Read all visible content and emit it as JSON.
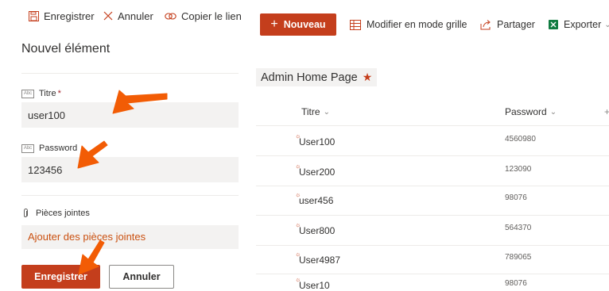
{
  "panel": {
    "commands": {
      "save": "Enregistrer",
      "cancel": "Annuler",
      "copy_link": "Copier le lien"
    },
    "title": "Nouvel élément",
    "fields": [
      {
        "label": "Titre",
        "required_mark": "*",
        "value": "user100"
      },
      {
        "label": "Password",
        "value": "123456"
      }
    ],
    "attachments": {
      "label": "Pièces jointes",
      "link": "Ajouter des pièces jointes"
    },
    "buttons": {
      "save": "Enregistrer",
      "cancel": "Annuler"
    }
  },
  "toolbar": {
    "new": "Nouveau",
    "grid": "Modifier en mode grille",
    "share": "Partager",
    "export": "Exporter"
  },
  "list": {
    "title": "Admin Home Page",
    "columns": [
      "Titre",
      "Password"
    ],
    "rows": [
      {
        "title": "User100",
        "password": "4560980"
      },
      {
        "title": "User200",
        "password": "123090"
      },
      {
        "title": "user456",
        "password": "98076"
      },
      {
        "title": "User800",
        "password": "564370"
      },
      {
        "title": "User4987",
        "password": "789065"
      },
      {
        "title": "User10",
        "password": "98076"
      }
    ]
  },
  "colors": {
    "accent": "#c43e1c",
    "annotation_arrow": "#f25c05"
  }
}
